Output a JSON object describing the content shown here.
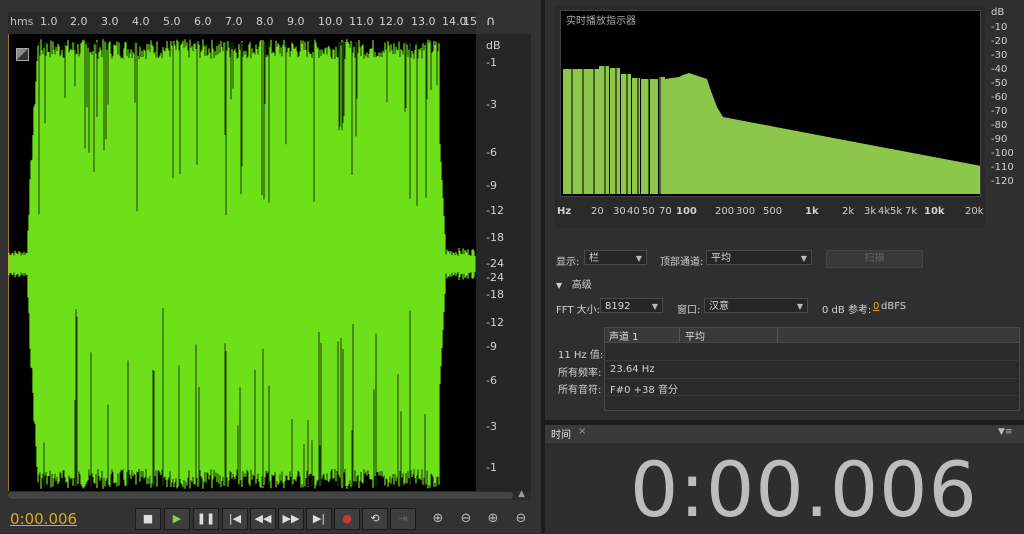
{
  "ruler": {
    "unit": "hms",
    "ticks": [
      "1.0",
      "2.0",
      "3.0",
      "4.0",
      "5.0",
      "6.0",
      "7.0",
      "8.0",
      "9.0",
      "10.0",
      "11.0",
      "12.0",
      "13.0",
      "14.0",
      "15"
    ]
  },
  "db_scale": {
    "labels": [
      "dB",
      "-1",
      "-3",
      "-6",
      "-9",
      "-12",
      "-18",
      "-24",
      "-24",
      "-18",
      "-12",
      "-9",
      "-6",
      "-3",
      "-1"
    ]
  },
  "transport": {
    "timecode": "0:00.006",
    "buttons": [
      "stop",
      "play",
      "pause",
      "move-to-start",
      "rewind",
      "fast-forward",
      "move-to-end",
      "record",
      "loop",
      "skip-selection"
    ]
  },
  "zoom_buttons": [
    "zoom-in-amplitude",
    "zoom-out-amplitude",
    "zoom-in-time",
    "zoom-out-time"
  ],
  "analyzer": {
    "title": "实时播放指示器",
    "db_labels": [
      "dB",
      "-10",
      "-20",
      "-30",
      "-40",
      "-50",
      "-60",
      "-70",
      "-80",
      "-90",
      "-100",
      "-110",
      "-120"
    ],
    "freq_labels": [
      "Hz",
      "20",
      "30",
      "40",
      "50",
      "70",
      "100",
      "200",
      "300",
      "500",
      "1k",
      "2k",
      "3k",
      "4k",
      "5k",
      "7k",
      "10k",
      "20k"
    ],
    "display_label": "显示:",
    "display_value": "栏",
    "channel_label": "顶部通道:",
    "channel_value": "平均",
    "scan_button": "扫描",
    "advanced_label": "高级",
    "fft_label": "FFT 大小:",
    "fft_value": "8192",
    "window_label": "窗口:",
    "window_value": "汉意",
    "ref_label": "0 dB 参考:",
    "ref_value": "0",
    "ref_unit": "dBFS",
    "table": {
      "col1": "声道 1",
      "col2": "平均",
      "row_labels": [
        "11 Hz 值:",
        "所有频率:",
        "所有音符:"
      ],
      "row_values": [
        "",
        "23.64 Hz",
        "F#0 +38 音分"
      ]
    }
  },
  "time_panel": {
    "tab_label": "时间",
    "close": "×",
    "value": "0:00.006"
  },
  "colors": {
    "waveform": "#6ee01a",
    "spectrum_bars": "#8cc64a",
    "timecode": "#e3a623"
  }
}
